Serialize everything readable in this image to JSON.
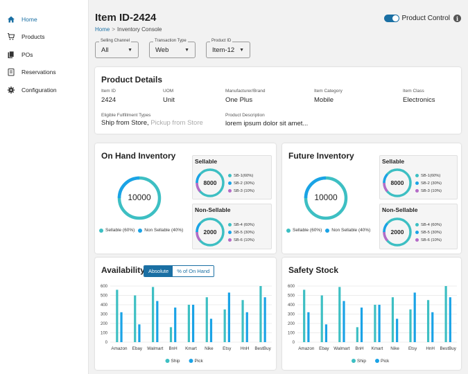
{
  "sidebar": {
    "items": [
      {
        "label": "Home",
        "icon": "home-icon",
        "active": true
      },
      {
        "label": "Products",
        "icon": "cart-icon",
        "active": false
      },
      {
        "label": "POs",
        "icon": "documents-icon",
        "active": false
      },
      {
        "label": "Reservations",
        "icon": "clipboard-icon",
        "active": false
      },
      {
        "label": "Configuration",
        "icon": "gear-icon",
        "active": false
      }
    ]
  },
  "header": {
    "title": "Item ID-2424",
    "breadcrumb": {
      "home": "Home",
      "separator": ">",
      "current": "Inventory Console"
    },
    "product_control_label": "Product Control",
    "info_glyph": "i"
  },
  "filters": [
    {
      "label": "Selling Channel",
      "value": "All"
    },
    {
      "label": "Transaction Type",
      "value": "Web"
    },
    {
      "label": "Product ID",
      "value": "Item-12"
    }
  ],
  "product_details": {
    "title": "Product Details",
    "item_id_label": "Item ID",
    "item_id": "2424",
    "uom_label": "UOM",
    "uom": "Unit",
    "brand_label": "Manufacturer/Brand",
    "brand": "One Plus",
    "category_label": "Item Category",
    "category": "Mobile",
    "class_label": "Item Class",
    "class": "Electronics",
    "fulfillment_label": "Eligible Fulfillment Types",
    "fulfillment_primary": "Ship from Store,",
    "fulfillment_secondary": "Pickup from Store",
    "description_label": "Product Description",
    "description": "lorem ipsum dolor sit amet..."
  },
  "colors": {
    "teal": "#3dbfc3",
    "blue": "#1aa3e6",
    "purple": "#b46bc7",
    "accent": "#1a6fa3"
  },
  "on_hand": {
    "title": "On Hand Inventory",
    "total": "10000",
    "legend": [
      {
        "label": "Sellable (60%)",
        "color": "#3dbfc3"
      },
      {
        "label": "Non Sellable (40%)",
        "color": "#1aa3e6"
      }
    ],
    "sellable": {
      "title": "Sellable",
      "total": "8000",
      "items": [
        "SB-1(60%)",
        "SB-2 (30%)",
        "SB-3 (10%)"
      ]
    },
    "non_sellable": {
      "title": "Non-Sellable",
      "total": "2000",
      "items": [
        "SB-4 (60%)",
        "SB-5 (30%)",
        "SB-6 (10%)"
      ]
    }
  },
  "future": {
    "title": "Future Inventory",
    "total": "10000",
    "legend": [
      {
        "label": "Sellable (60%)",
        "color": "#3dbfc3"
      },
      {
        "label": "Non Sellable (40%)",
        "color": "#1aa3e6"
      }
    ],
    "sellable": {
      "title": "Sellable",
      "total": "8000",
      "items": [
        "SB-1(60%)",
        "SB-2 (30%)",
        "SB-3 (10%)"
      ]
    },
    "non_sellable": {
      "title": "Non-Sellable",
      "total": "2000",
      "items": [
        "SB-4 (60%)",
        "SB-5 (30%)",
        "SB-6 (10%)"
      ]
    }
  },
  "availability": {
    "title": "Availability",
    "toggle_on": "Absolute",
    "toggle_off": "% of On Hand"
  },
  "safety": {
    "title": "Safety Stock"
  },
  "chart_data": [
    {
      "type": "bar",
      "title": "Availability",
      "categories": [
        "Amazon",
        "Ebay",
        "Walmart",
        "BnH",
        "Kmart",
        "Nike",
        "Etsy",
        "HnH",
        "BestBuy"
      ],
      "series": [
        {
          "name": "Ship",
          "color": "#3dbfc3",
          "values": [
            560,
            500,
            590,
            160,
            400,
            480,
            350,
            450,
            600
          ]
        },
        {
          "name": "Pick",
          "color": "#1aa3e6",
          "values": [
            320,
            190,
            440,
            370,
            400,
            250,
            530,
            320,
            480
          ]
        }
      ],
      "yticks": [
        0,
        100,
        200,
        300,
        400,
        500,
        600
      ],
      "ylim": [
        0,
        600
      ],
      "legend": "bottom"
    },
    {
      "type": "bar",
      "title": "Safety Stock",
      "categories": [
        "Amazon",
        "Ebay",
        "Walmart",
        "BnH",
        "Kmart",
        "Nike",
        "Etsy",
        "HnH",
        "BestBuy"
      ],
      "series": [
        {
          "name": "Ship",
          "color": "#3dbfc3",
          "values": [
            560,
            500,
            590,
            160,
            400,
            480,
            350,
            450,
            600
          ]
        },
        {
          "name": "Pick",
          "color": "#1aa3e6",
          "values": [
            320,
            190,
            440,
            370,
            400,
            250,
            530,
            320,
            480
          ]
        }
      ],
      "yticks": [
        0,
        100,
        200,
        300,
        400,
        500,
        600
      ],
      "ylim": [
        0,
        600
      ],
      "legend": "bottom"
    }
  ]
}
